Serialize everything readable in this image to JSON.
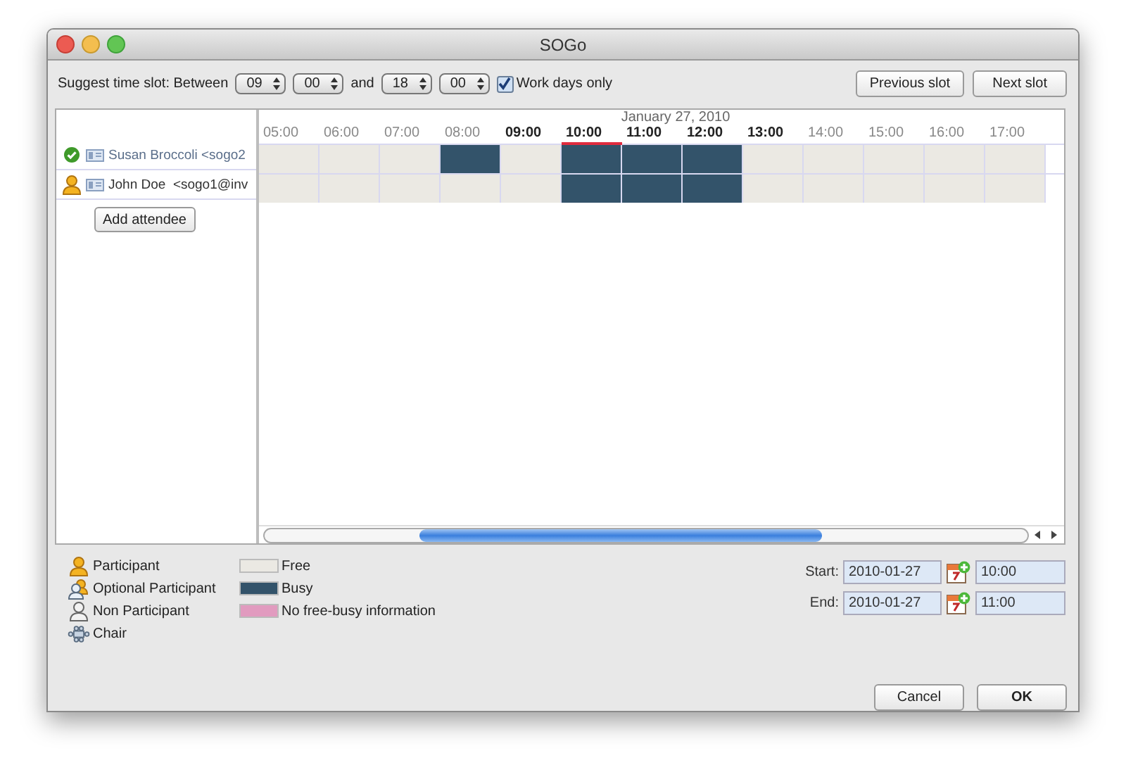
{
  "window": {
    "title": "SOGo"
  },
  "suggest": {
    "label": "Suggest time slot: Between",
    "from_hour": "09",
    "from_minute": "00",
    "and_label": "and",
    "to_hour": "18",
    "to_minute": "00",
    "work_days": {
      "label": "Work days only",
      "checked": true
    }
  },
  "slot_buttons": [
    "Previous slot",
    "Next slot"
  ],
  "schedule": {
    "date": "January 27, 2010",
    "hours": [
      {
        "label": "05:00",
        "bold": false,
        "selected": false
      },
      {
        "label": "06:00",
        "bold": false,
        "selected": false
      },
      {
        "label": "07:00",
        "bold": false,
        "selected": false
      },
      {
        "label": "08:00",
        "bold": false,
        "selected": false
      },
      {
        "label": "09:00",
        "bold": true,
        "selected": false
      },
      {
        "label": "10:00",
        "bold": true,
        "selected": true
      },
      {
        "label": "11:00",
        "bold": true,
        "selected": false
      },
      {
        "label": "12:00",
        "bold": true,
        "selected": false
      },
      {
        "label": "13:00",
        "bold": true,
        "selected": false
      },
      {
        "label": "14:00",
        "bold": false,
        "selected": false
      },
      {
        "label": "15:00",
        "bold": false,
        "selected": false
      },
      {
        "label": "16:00",
        "bold": false,
        "selected": false
      },
      {
        "label": "17:00",
        "bold": false,
        "selected": false
      }
    ],
    "attendees": [
      {
        "kind": "accepted",
        "name": "Susan Broccoli <sogo2",
        "slots": [
          {
            "busy": false
          },
          {
            "busy": false
          },
          {
            "busy": false
          },
          {
            "busy": true
          },
          {
            "busy": false
          },
          {
            "busy": true
          },
          {
            "busy": true
          },
          {
            "busy": true
          },
          {
            "busy": false
          },
          {
            "busy": false
          },
          {
            "busy": false
          },
          {
            "busy": false
          },
          {
            "busy": false
          }
        ]
      },
      {
        "kind": "participant",
        "name": "John Doe  <sogo1@inv",
        "slots": [
          {
            "busy": false
          },
          {
            "busy": false
          },
          {
            "busy": false
          },
          {
            "busy": false
          },
          {
            "busy": false
          },
          {
            "busy": true
          },
          {
            "busy": true
          },
          {
            "busy": true
          },
          {
            "busy": false
          },
          {
            "busy": false
          },
          {
            "busy": false
          },
          {
            "busy": false
          },
          {
            "busy": false
          }
        ]
      }
    ],
    "add_button": "Add attendee"
  },
  "roles": [
    {
      "kind": "participant",
      "label": "Participant"
    },
    {
      "kind": "optional",
      "label": "Optional Participant"
    },
    {
      "kind": "non",
      "label": "Non Participant"
    },
    {
      "kind": "chair",
      "label": "Chair"
    }
  ],
  "statuses": [
    {
      "label": "Free",
      "color": "#ebe9e3"
    },
    {
      "label": "Busy",
      "color": "#33536a"
    },
    {
      "label": "No free-busy information",
      "color": "#e19bbf"
    }
  ],
  "times": [
    {
      "label": "Start:",
      "date": "2010-01-27",
      "time": "10:00"
    },
    {
      "label": "End:",
      "date": "2010-01-27",
      "time": "11:00"
    }
  ],
  "buttons": [
    "Cancel",
    "OK"
  ]
}
